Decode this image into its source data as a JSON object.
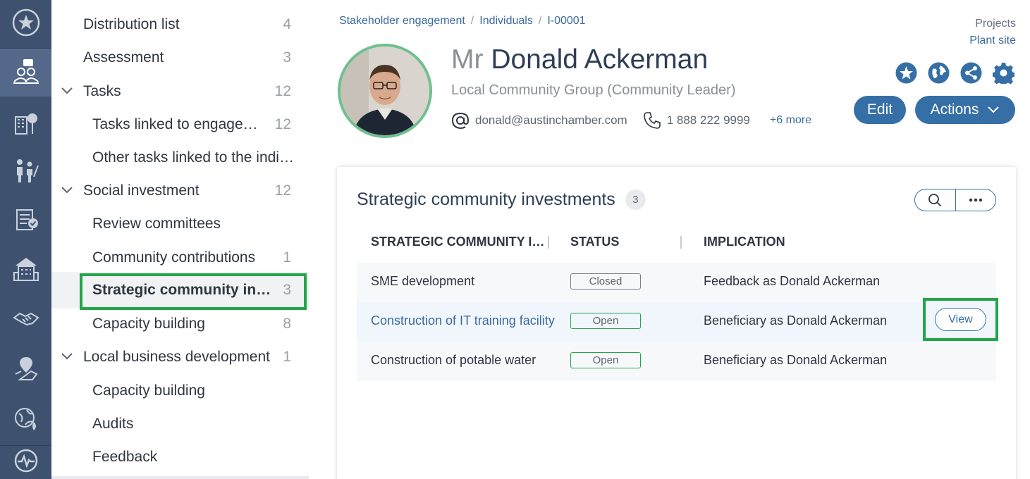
{
  "rail": {
    "icons": [
      "star-icon",
      "engagement-icon",
      "buildings-icon",
      "people-icon",
      "checklist-icon",
      "organization-icon",
      "handshake-icon",
      "map-pin-icon",
      "environment-icon",
      "activity-icon"
    ],
    "active_index": 1
  },
  "nav": {
    "items": [
      {
        "label": "Distribution list",
        "count": "4",
        "level": 0
      },
      {
        "label": "Assessment",
        "count": "3",
        "level": 0
      },
      {
        "label": "Tasks",
        "count": "12",
        "level": 0,
        "expanded": true
      },
      {
        "label": "Tasks linked to engagements",
        "count": "12",
        "level": 1
      },
      {
        "label": "Other tasks linked to the individual",
        "count": "",
        "level": 1
      },
      {
        "label": "Social investment",
        "count": "12",
        "level": 0,
        "expanded": true
      },
      {
        "label": "Review committees",
        "count": "",
        "level": 1
      },
      {
        "label": "Community contributions",
        "count": "1",
        "level": 1
      },
      {
        "label": "Strategic community investments",
        "count": "3",
        "level": 1,
        "selected": true
      },
      {
        "label": "Capacity building",
        "count": "8",
        "level": 1
      },
      {
        "label": "Local business development",
        "count": "1",
        "level": 0,
        "expanded": true
      },
      {
        "label": "Capacity building",
        "count": "",
        "level": 1
      },
      {
        "label": "Audits",
        "count": "",
        "level": 1
      },
      {
        "label": "Feedback",
        "count": "",
        "level": 1
      }
    ]
  },
  "breadcrumb": [
    "Stakeholder engagement",
    "Individuals",
    "I-00001"
  ],
  "projects": {
    "label": "Projects",
    "value": "Plant site"
  },
  "profile": {
    "honorific": "Mr",
    "name": "Donald Ackerman",
    "role": "Local Community Group (Community Leader)",
    "email": "donald@austinchamber.com",
    "phone": "1 888 222 9999",
    "more": "+6 more"
  },
  "header_actions": {
    "icons": [
      "favorite-icon",
      "globe-icon",
      "share-icon",
      "settings-icon"
    ],
    "edit_label": "Edit",
    "actions_label": "Actions"
  },
  "card": {
    "title": "Strategic community investments",
    "count": "3",
    "columns": [
      "STRATEGIC COMMUNITY INVESTMENT",
      "STATUS",
      "IMPLICATION"
    ],
    "rows": [
      {
        "name": "SME development",
        "status": "Closed",
        "implication": "Feedback as Donald Ackerman"
      },
      {
        "name": "Construction of IT training facility",
        "status": "Open",
        "implication": "Beneficiary as Donald Ackerman"
      },
      {
        "name": "Construction of potable water",
        "status": "Open",
        "implication": "Beneficiary as Donald Ackerman"
      }
    ],
    "view_label": "View"
  },
  "colors": {
    "rail": "#3e5270",
    "accent": "#356fa6",
    "highlight": "#21a649"
  }
}
